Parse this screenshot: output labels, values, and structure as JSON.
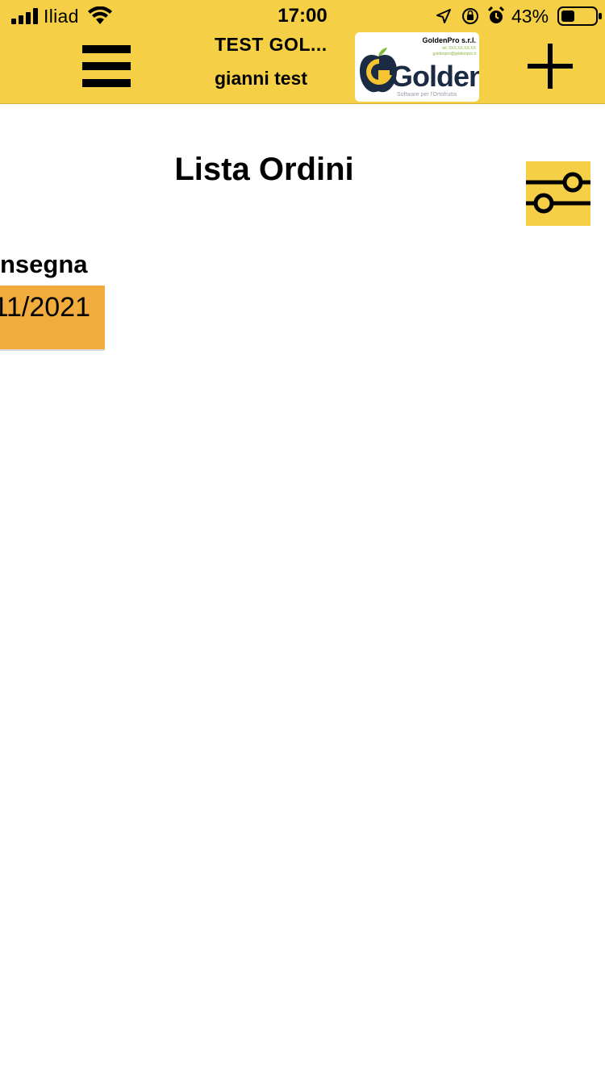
{
  "status_bar": {
    "carrier": "Iliad",
    "time": "17:00",
    "battery_percent": "43%"
  },
  "app_bar": {
    "title": "TEST GOL...",
    "subtitle": "gianni test",
    "logo": {
      "company": "GoldenPro s.r.l.",
      "tel": "tel. 0XX.XX.XX.XX",
      "email": "goldenpro@goldenpro.it",
      "word": "Golden",
      "tagline": "Software per l'Ortofrutta"
    }
  },
  "main": {
    "page_title": "Lista Ordini",
    "column_header": "nsegna",
    "rows": [
      {
        "date": "11/2021"
      }
    ]
  },
  "colors": {
    "header_yellow": "#f5cf45",
    "row_orange": "#f2ab3d"
  }
}
